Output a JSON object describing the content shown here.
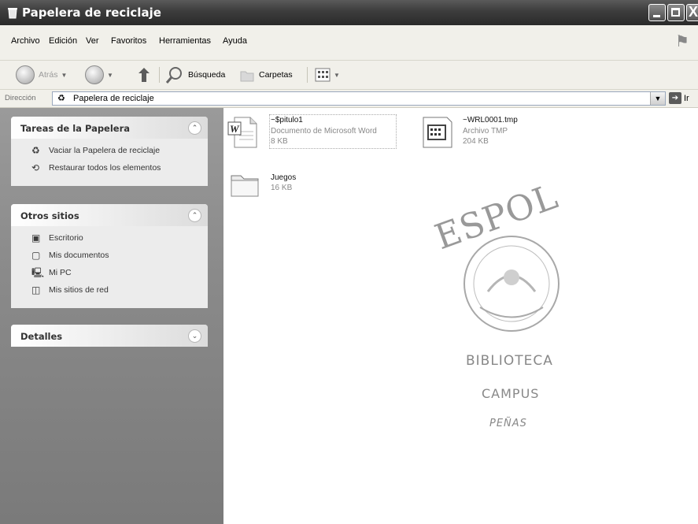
{
  "window": {
    "title": "Papelera de reciclaje",
    "controls": {
      "minimize": "",
      "maximize": "",
      "close": "X"
    }
  },
  "menubar": {
    "items": [
      "Archivo",
      "Edición",
      "Ver",
      "Favoritos",
      "Herramientas",
      "Ayuda"
    ]
  },
  "toolbar": {
    "back_label": "Atrás",
    "search_label": "Búsqueda",
    "folders_label": "Carpetas"
  },
  "address": {
    "label": "Dirección",
    "value": "Papelera de reciclaje",
    "go_label": "Ir"
  },
  "sidebar": {
    "panels": [
      {
        "title": "Tareas de la Papelera",
        "toggle": "⌃",
        "items": [
          {
            "label": "Vaciar la Papelera de reciclaje",
            "icon": "recycle-bin-icon"
          },
          {
            "label": "Restaurar todos los elementos",
            "icon": "restore-icon"
          }
        ]
      },
      {
        "title": "Otros sitios",
        "toggle": "⌃",
        "items": [
          {
            "label": "Escritorio",
            "icon": "desktop-icon"
          },
          {
            "label": "Mis documentos",
            "icon": "folder-icon"
          },
          {
            "label": "Mi PC",
            "icon": "computer-icon"
          },
          {
            "label": "Mis sitios de red",
            "icon": "network-icon"
          }
        ]
      },
      {
        "title": "Detalles",
        "toggle": "⌄"
      }
    ]
  },
  "files": [
    {
      "name": "~$pitulo1",
      "type": "Documento de Microsoft Word",
      "size": "8 KB",
      "icon": "word-document-icon"
    },
    {
      "name": "~WRL0001.tmp",
      "type": "Archivo TMP",
      "size": "204 KB",
      "icon": "tmp-file-icon"
    },
    {
      "name": "Juegos",
      "type": "",
      "size": "16 KB",
      "icon": "folder-icon"
    }
  ],
  "stamp": {
    "lines": [
      "ESPOL",
      "BIBLIOTECA",
      "CAMPUS",
      "PEÑAS"
    ]
  },
  "colors": {
    "titlebar": "#3c3c3c",
    "sidebar": "#8a8a8a",
    "chrome": "#f1f0ea"
  }
}
